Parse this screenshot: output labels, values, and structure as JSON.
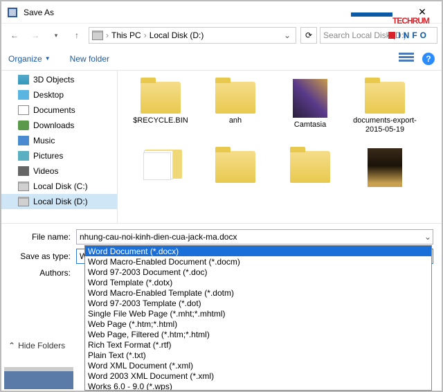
{
  "window": {
    "title": "Save As"
  },
  "nav": {
    "crumbs": [
      "This PC",
      "Local Disk (D:)"
    ],
    "search_placeholder": "Search Local Disk (D:)"
  },
  "toolbar": {
    "organize": "Organize",
    "newfolder": "New folder"
  },
  "sidebar": {
    "items": [
      {
        "label": "3D Objects",
        "icon": "obj"
      },
      {
        "label": "Desktop",
        "icon": "desk"
      },
      {
        "label": "Documents",
        "icon": "doc"
      },
      {
        "label": "Downloads",
        "icon": "down"
      },
      {
        "label": "Music",
        "icon": "music"
      },
      {
        "label": "Pictures",
        "icon": "pic"
      },
      {
        "label": "Videos",
        "icon": "vid"
      },
      {
        "label": "Local Disk (C:)",
        "icon": "drive"
      },
      {
        "label": "Local Disk (D:)",
        "icon": "drive",
        "selected": true
      }
    ]
  },
  "items": [
    {
      "label": "$RECYCLE.BIN",
      "type": "folder"
    },
    {
      "label": "anh",
      "type": "folder"
    },
    {
      "label": "Camtasia",
      "type": "camtasia"
    },
    {
      "label": "documents-export-2015-05-19",
      "type": "folder"
    },
    {
      "label": "",
      "type": "open"
    },
    {
      "label": "",
      "type": "folder"
    },
    {
      "label": "",
      "type": "folder"
    },
    {
      "label": "",
      "type": "dark"
    }
  ],
  "form": {
    "filename_label": "File name:",
    "filename_value": "nhung-cau-noi-kinh-dien-cua-jack-ma.docx",
    "type_label": "Save as type:",
    "type_value": "Word Document (*.docx)",
    "authors_label": "Authors:",
    "hide": "Hide Folders"
  },
  "type_options": [
    "Word Document (*.docx)",
    "Word Macro-Enabled Document (*.docm)",
    "Word 97-2003 Document (*.doc)",
    "Word Template (*.dotx)",
    "Word Macro-Enabled Template (*.dotm)",
    "Word 97-2003 Template (*.dot)",
    "Single File Web Page (*.mht;*.mhtml)",
    "Web Page (*.htm;*.html)",
    "Web Page, Filtered (*.htm;*.html)",
    "Rich Text Format (*.rtf)",
    "Plain Text (*.txt)",
    "Word XML Document (*.xml)",
    "Word 2003 XML Document (*.xml)",
    "Works 6.0 - 9.0 (*.wps)"
  ],
  "watermark": {
    "brand": "TECHRUM",
    "sub": "INFO"
  }
}
